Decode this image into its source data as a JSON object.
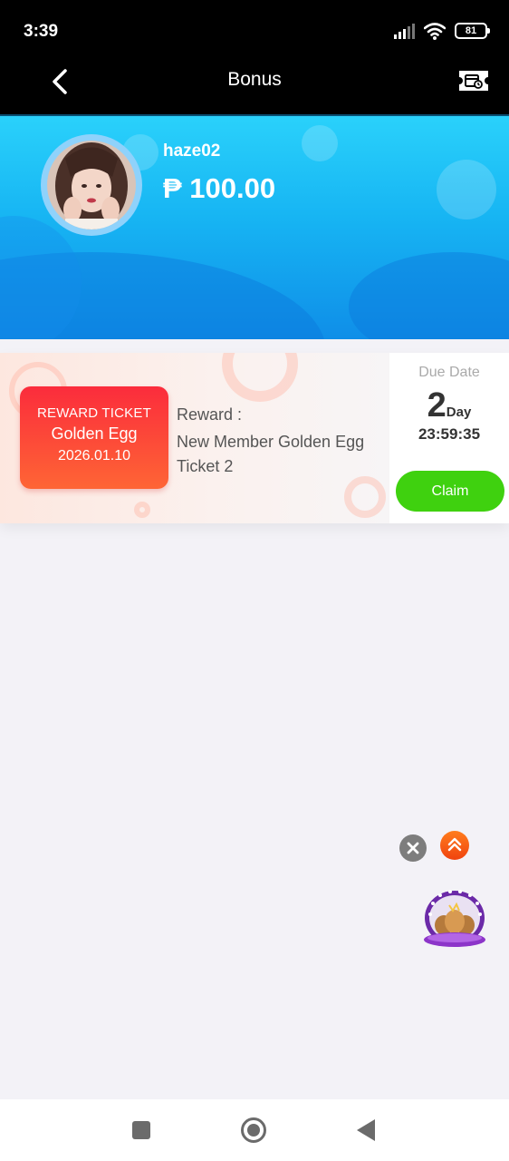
{
  "status_bar": {
    "time": "3:39",
    "battery_level": "81",
    "icons": [
      "signal-icon",
      "wifi-icon",
      "battery-icon"
    ]
  },
  "nav": {
    "title": "Bonus",
    "back_icon": "chevron-left-icon",
    "action_icon": "ticket-icon"
  },
  "profile": {
    "username": "haze02",
    "balance": "₱ 100.00"
  },
  "tickets": [
    {
      "type": "REWARD TICKET",
      "name": "Golden Egg",
      "date": "2026.01.10",
      "reward_label": "Reward :",
      "reward_desc": "New Member Golden Egg Ticket 2",
      "due_label": "Due Date",
      "due_days": "2",
      "due_days_unit": "Day",
      "due_time": "23:59:35",
      "claim_label": "Claim"
    }
  ],
  "floating": {
    "close_icon": "close-icon",
    "scroll_top_icon": "double-chevron-up-icon",
    "promo_icon": "golden-egg-promo-icon"
  },
  "system_nav": {
    "icons": [
      "recent-apps-icon",
      "home-icon",
      "back-icon"
    ]
  },
  "colors": {
    "header_gradient_top": "#2ad1fb",
    "header_gradient_bottom": "#0f8ee8",
    "badge_red": "#fb2c3c",
    "badge_orange": "#fe6535",
    "claim_green": "#3fd10f"
  }
}
